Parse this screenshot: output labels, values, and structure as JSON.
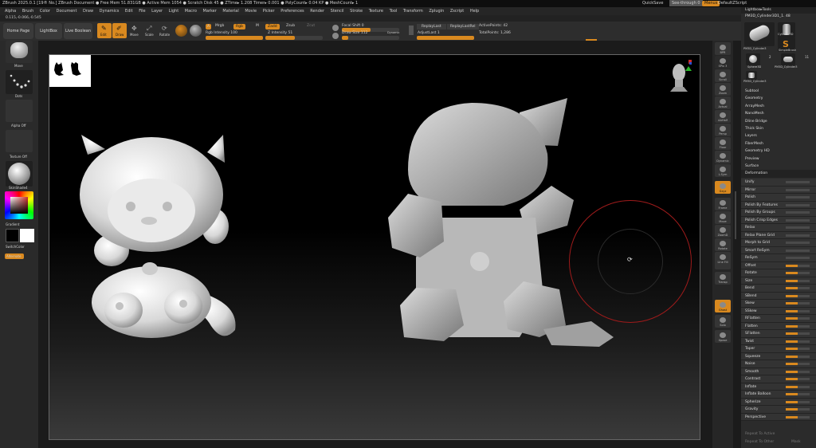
{
  "titlebar": {
    "text": "ZBrush 2025.0.1 [19® No.]   ZBrush Document    ● Free Mem 51.831GB ● Active Mem 1054 ● Scratch Disk 45 ● ZTime▸ 1.208 Timer▸ 0.001 ● PolyCount▸ 0.04 KP ● MeshCount▸ 1",
    "quicksave": "QuickSave",
    "seethrough": "See-through 0",
    "menus_label": "Menus",
    "zscript": "DefaultZScript"
  },
  "menubar": {
    "items": [
      "Alpha",
      "Brush",
      "Color",
      "Document",
      "Draw",
      "Dynamics",
      "Edit",
      "File",
      "Layer",
      "Light",
      "Macro",
      "Marker",
      "Material",
      "Movie",
      "Picker",
      "Preferences",
      "Render",
      "Stencil",
      "Stroke",
      "Texture",
      "Tool",
      "Transform",
      "Zplugin",
      "Zscript",
      "Help"
    ]
  },
  "coords": "0.115,-0.066,-0.545",
  "toolbar": {
    "home_page": "Home Page",
    "lightbox": "LightBox",
    "live_boolean": "Live Boolean",
    "edit": "Edit",
    "draw": "Draw",
    "move": "Move",
    "scale": "Scale",
    "rotate": "Rotate",
    "a_label": "A",
    "mrgb": "Mrgb",
    "rgb": "Rgb",
    "m": "M",
    "zadd": "Zadd",
    "zsub": "Zsub",
    "zcut": "Zcut",
    "rgb_intensity": "Rgb Intensity 100",
    "z_intensity": "Z Intensity 51",
    "focal_shift": "Focal Shift 0",
    "draw_size": "Draw Size 112",
    "dynamic": "Dynamic",
    "replay_last": "ReplayLast",
    "replay_last_rel": "ReplayLastRel",
    "adjust_last": "AdjustLast 1",
    "active_points": "ActivePoints: 42",
    "total_points": "TotalPoints: 1,286"
  },
  "leftpanel": {
    "move": "Move",
    "dots": "Dots",
    "alpha_off": "Alpha Off",
    "texture_off": "Texture Off",
    "material": "SkinShade4",
    "gradient": "Gradient",
    "switch_color": "SwitchColor",
    "alternate": "Alternate"
  },
  "rightshelf": {
    "items": [
      "BPR",
      "SPix 3",
      "Scroll",
      "Zoom",
      "Actual",
      "AAHalf",
      "Persp",
      "Floor",
      "Dynamic",
      "L.Sym",
      "Gxyz",
      "Frame",
      "Move",
      "ZoomD",
      "Rotate",
      "Line Fill PolyF",
      "Transp",
      "Ghost",
      "Solo",
      "Xpose"
    ]
  },
  "rightpanel": {
    "title": "Lightbox▸Tools",
    "tool_name": "PM3D_Cylinder3D1_1. 48",
    "tool_thumbs": [
      "PM3D_Cylinder3",
      "Cylinder3D",
      "SimpleBrush",
      "Sphere3D",
      "PM3D_Cylinder3",
      "PM3D_Cylinder3"
    ],
    "thumb_counts": [
      "2",
      "11"
    ],
    "sections": [
      "Subtool",
      "Geometry",
      "ArrayMesh",
      "NanoMesh",
      "Dline Bridge",
      "Thick Skin",
      "Layers",
      "FiberMesh",
      "Geometry HD",
      "Preview",
      "Surface",
      "Deformation"
    ],
    "deformation_items": [
      {
        "label": "Unify",
        "level": 0
      },
      {
        "label": "Mirror",
        "level": 0
      },
      {
        "label": "Polish",
        "level": 0
      },
      {
        "label": "Polish By Features",
        "level": 0
      },
      {
        "label": "Polish By Groups",
        "level": 0
      },
      {
        "label": "Polish Crisp Edges",
        "level": 0
      },
      {
        "label": "Relax",
        "level": 0
      },
      {
        "label": "Relax Plane Grid",
        "level": 0
      },
      {
        "label": "Morph to Grid",
        "level": 0
      },
      {
        "label": "Smart ReSym",
        "level": 0
      },
      {
        "label": "ReSym",
        "level": 0
      },
      {
        "label": "Offset",
        "level": 0.5
      },
      {
        "label": "Rotate",
        "level": 0.5
      },
      {
        "label": "Size",
        "level": 0.5
      },
      {
        "label": "Bend",
        "level": 0.5
      },
      {
        "label": "SBend",
        "level": 0.5
      },
      {
        "label": "Skew",
        "level": 0.5
      },
      {
        "label": "SSkew",
        "level": 0.5
      },
      {
        "label": "RFlatten",
        "level": 0.5
      },
      {
        "label": "Flatten",
        "level": 0.5
      },
      {
        "label": "SFlatten",
        "level": 0.5
      },
      {
        "label": "Twist",
        "level": 0.5
      },
      {
        "label": "Taper",
        "level": 0.5
      },
      {
        "label": "Squeeze",
        "level": 0.5
      },
      {
        "label": "Noise",
        "level": 0.5
      },
      {
        "label": "Smooth",
        "level": 0.5
      },
      {
        "label": "Contrast",
        "level": 0.5
      },
      {
        "label": "Inflate",
        "level": 0.5
      },
      {
        "label": "Inflate Balloon",
        "level": 0.5
      },
      {
        "label": "Spherize",
        "level": 0.5
      },
      {
        "label": "Gravity",
        "level": 0.5
      },
      {
        "label": "Perspective",
        "level": 0.5
      }
    ],
    "bottom": [
      "Repeat To Active",
      "Repeat To Other",
      "Mask"
    ]
  },
  "colors": {
    "accent": "#d9891f",
    "brush_circle": "#9e1b1b"
  }
}
